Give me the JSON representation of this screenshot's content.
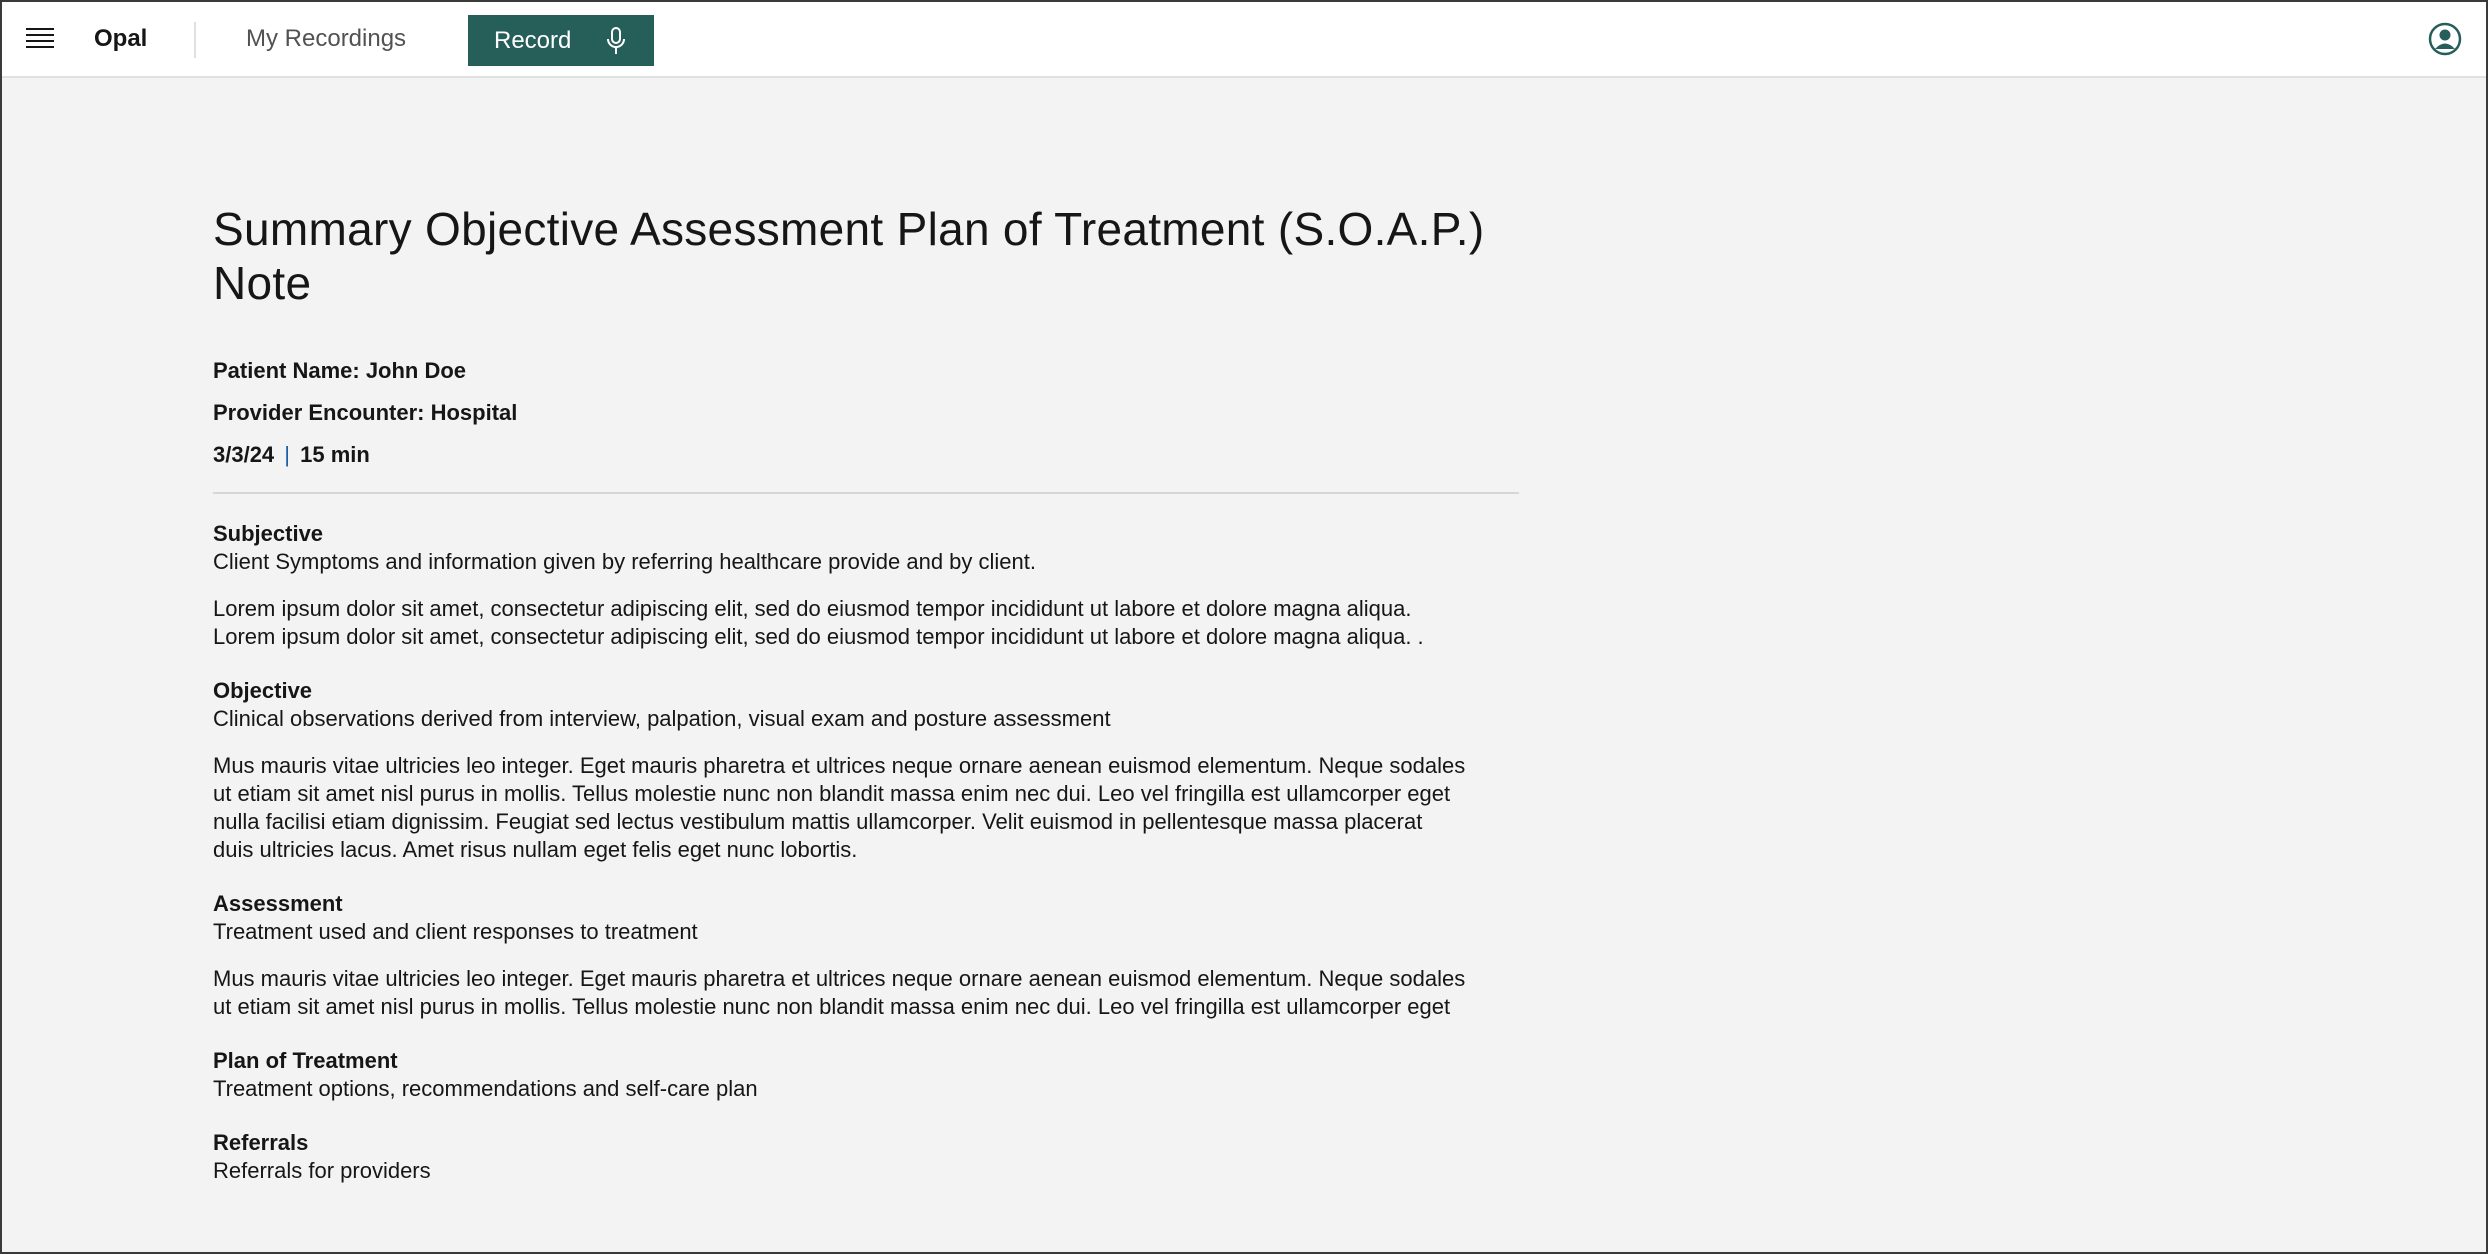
{
  "app": {
    "brand": "Opal"
  },
  "nav": {
    "my_recordings": "My Recordings",
    "record_label": "Record"
  },
  "colors": {
    "accent": "#265e5a",
    "page_bg": "#f3f3f3"
  },
  "note": {
    "title": "Summary Objective Assessment Plan of Treatment (S.O.A.P.) Note",
    "patient": "Patient Name: John Doe",
    "encounter": "Provider Encounter: Hospital",
    "date": "3/3/24",
    "date_sep": "|",
    "duration": "15 min",
    "sections": [
      {
        "heading": "Subjective",
        "description": "Client Symptoms and information given by referring healthcare provide and by client.",
        "body_lines": [
          "Lorem ipsum dolor sit amet, consectetur adipiscing elit, sed do eiusmod tempor incididunt ut labore et dolore magna aliqua.",
          "Lorem ipsum dolor sit amet, consectetur adipiscing elit, sed do eiusmod tempor incididunt ut labore et dolore magna aliqua. ."
        ]
      },
      {
        "heading": "Objective",
        "description": "Clinical observations derived from interview, palpation, visual exam and posture assessment",
        "body_lines": [
          "Mus mauris vitae ultricies leo integer. Eget mauris pharetra et ultrices neque ornare aenean euismod elementum. Neque sodales",
          "ut etiam sit amet nisl purus in mollis. Tellus molestie nunc non blandit massa enim nec dui. Leo vel fringilla est ullamcorper eget",
          "nulla facilisi etiam dignissim. Feugiat sed lectus vestibulum mattis ullamcorper. Velit euismod in pellentesque massa placerat",
          "duis ultricies lacus. Amet risus nullam eget felis eget nunc lobortis."
        ]
      },
      {
        "heading": "Assessment",
        "description": "Treatment used and client responses to treatment",
        "body_lines": [
          "Mus mauris vitae ultricies leo integer. Eget mauris pharetra et ultrices neque ornare aenean euismod elementum. Neque sodales",
          "ut etiam sit amet nisl purus in mollis. Tellus molestie nunc non blandit massa enim nec dui. Leo vel fringilla est ullamcorper eget"
        ]
      },
      {
        "heading": "Plan of Treatment",
        "description": "Treatment options, recommendations and self-care plan",
        "body_lines": []
      },
      {
        "heading": "Referrals",
        "description": "Referrals for providers",
        "body_lines": []
      }
    ]
  },
  "icons": {
    "menu": "hamburger-menu-icon",
    "mic": "microphone-icon",
    "user": "user-avatar-icon"
  }
}
